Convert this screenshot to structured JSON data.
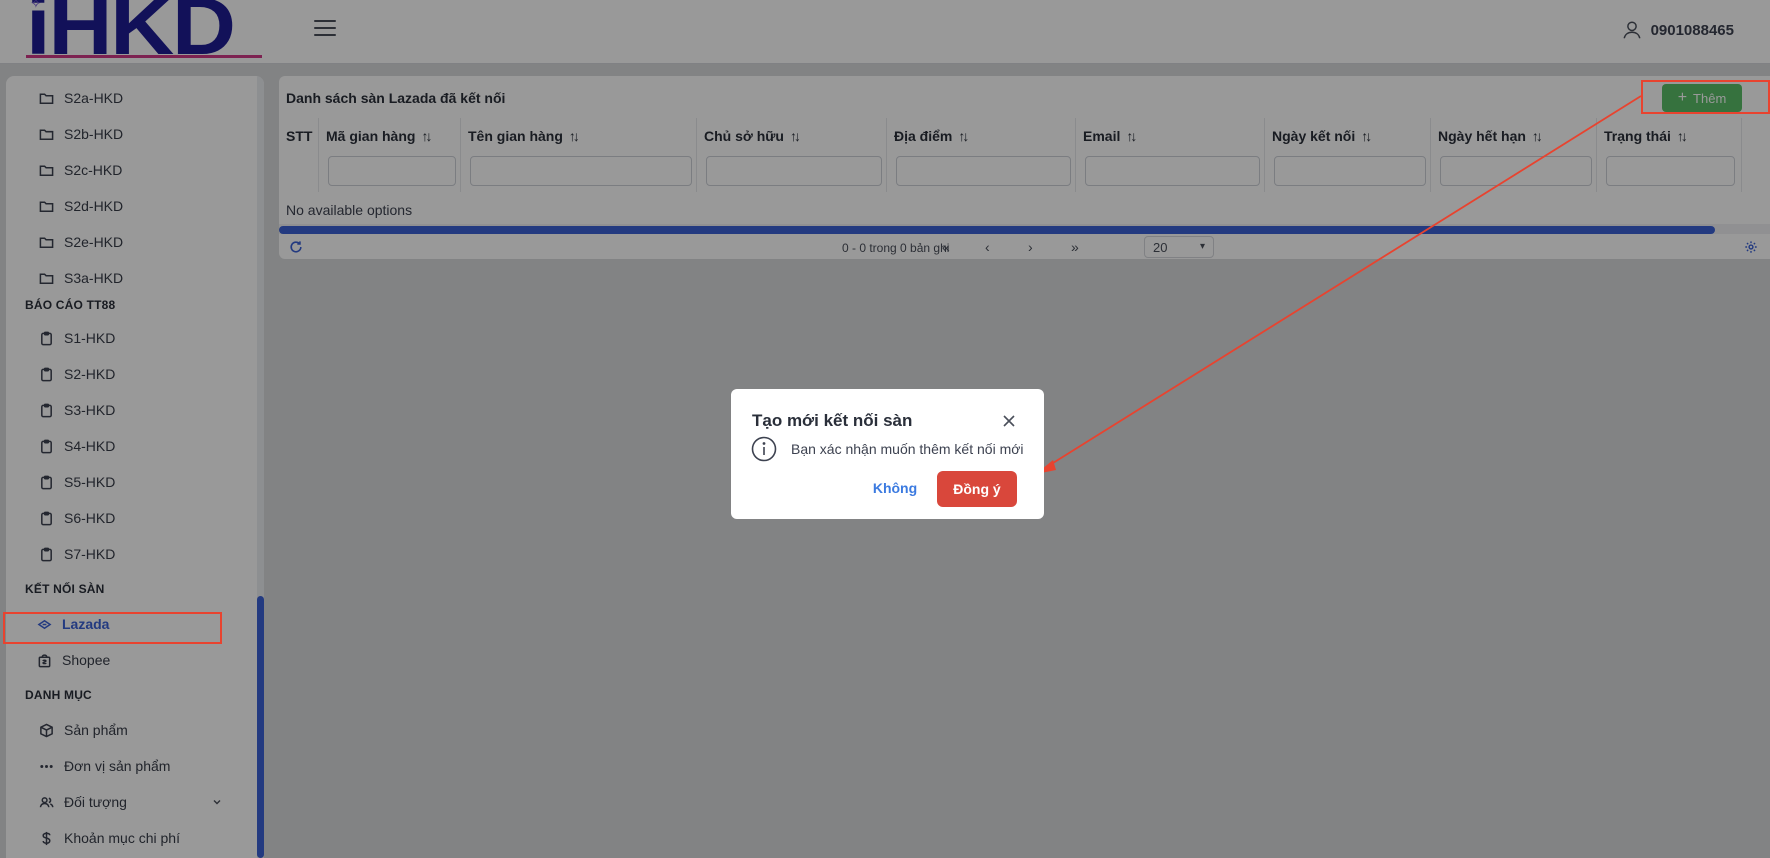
{
  "header": {
    "logo_text": "iHKD",
    "user_phone": "0901088465"
  },
  "sidebar": {
    "items_top": [
      {
        "label": "S2a-HKD",
        "icon": "folder-icon"
      },
      {
        "label": "S2b-HKD",
        "icon": "folder-icon"
      },
      {
        "label": "S2c-HKD",
        "icon": "folder-icon"
      },
      {
        "label": "S2d-HKD",
        "icon": "folder-icon"
      },
      {
        "label": "S2e-HKD",
        "icon": "folder-icon"
      },
      {
        "label": "S3a-HKD",
        "icon": "folder-icon"
      }
    ],
    "section_tt88": "BÁO CÁO TT88",
    "items_tt88": [
      {
        "label": "S1-HKD",
        "icon": "clipboard-icon"
      },
      {
        "label": "S2-HKD",
        "icon": "clipboard-icon"
      },
      {
        "label": "S3-HKD",
        "icon": "clipboard-icon"
      },
      {
        "label": "S4-HKD",
        "icon": "clipboard-icon"
      },
      {
        "label": "S5-HKD",
        "icon": "clipboard-icon"
      },
      {
        "label": "S6-HKD",
        "icon": "clipboard-icon"
      },
      {
        "label": "S7-HKD",
        "icon": "clipboard-icon"
      }
    ],
    "section_connect": "KẾT NỐI SÀN",
    "items_connect": [
      {
        "label": "Lazada",
        "icon": "lazada-icon",
        "active": true
      },
      {
        "label": "Shopee",
        "icon": "shopee-bag-icon"
      }
    ],
    "section_catalog": "DANH MỤC",
    "items_catalog": [
      {
        "label": "Sản phẩm",
        "icon": "box-icon"
      },
      {
        "label": "Đơn vị sản phẩm",
        "icon": "dots-icon"
      },
      {
        "label": "Đối tượng",
        "icon": "users-icon"
      },
      {
        "label": "Khoản mục chi phí",
        "icon": "dollar-icon"
      }
    ]
  },
  "panel": {
    "title": "Danh sách sàn Lazada đã kết nối",
    "add_label": "Thêm",
    "columns": [
      "STT",
      "Mã gian hàng",
      "Tên gian hàng",
      "Chủ sở hữu",
      "Địa điểm",
      "Email",
      "Ngày kết nối",
      "Ngày hết hạn",
      "Trạng thái"
    ],
    "sort_glyph": "↑↓",
    "empty_text": "No available options",
    "pager_info": "0 - 0 trong 0 bản ghi",
    "page_size": "20"
  },
  "dialog": {
    "title": "Tạo mới kết nối sàn",
    "message": "Bạn xác nhận muốn thêm kết nối mới",
    "no_label": "Không",
    "yes_label": "Đồng ý"
  },
  "colors": {
    "accent": "#3b62d6",
    "add_button": "#5abf68",
    "confirm_button": "#d9473b",
    "annotation": "#e8432f",
    "logo": "#1f1d94"
  }
}
